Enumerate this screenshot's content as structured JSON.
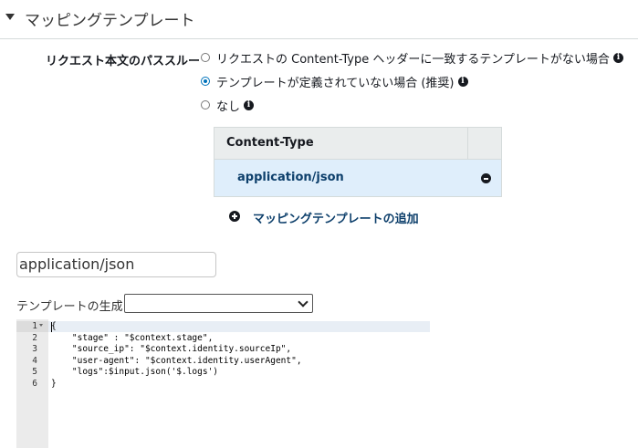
{
  "section": {
    "title": "マッピングテンプレート"
  },
  "passthrough": {
    "label": "リクエスト本文のパススルー",
    "options": [
      {
        "label": "リクエストの Content-Type ヘッダーに一致するテンプレートがない場合",
        "checked": false
      },
      {
        "label": "テンプレートが定義されていない場合 (推奨)",
        "checked": true
      },
      {
        "label": "なし",
        "checked": false
      }
    ]
  },
  "content_type_table": {
    "header": "Content-Type",
    "rows": [
      "application/json"
    ],
    "add_link": "マッピングテンプレートの追加"
  },
  "content_type_input": {
    "value": "application/json"
  },
  "template_generator": {
    "label": "テンプレートの生成:",
    "selected": ""
  },
  "editor": {
    "line_numbers": [
      "1",
      "2",
      "3",
      "4",
      "5",
      "6"
    ],
    "lines": [
      "{",
      "    \"stage\" : \"$context.stage\",",
      "    \"source_ip\": \"$context.identity.sourceIp\",",
      "    \"user-agent\": \"$context.identity.userAgent\",",
      "    \"logs\":$input.json('$.logs')",
      "}"
    ]
  }
}
